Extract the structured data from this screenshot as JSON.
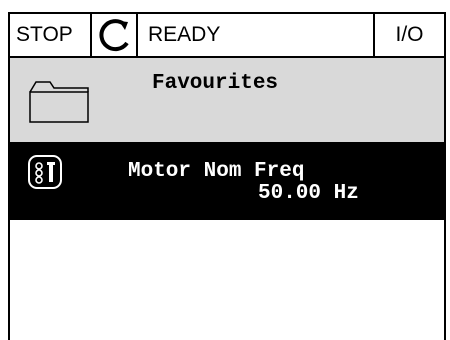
{
  "status_bar": {
    "state": "STOP",
    "rotation_icon": "rotation-direction-icon",
    "readiness": "READY",
    "control_place": "I/O"
  },
  "header": {
    "icon": "folder-icon",
    "title": "Favourites"
  },
  "selected_item": {
    "icon": "parameter-icon",
    "name": "Motor Nom Freq",
    "value": "50.00 Hz"
  },
  "colors": {
    "header_bg": "#d9d9d9",
    "selected_bg": "#000000",
    "selected_fg": "#ffffff"
  }
}
